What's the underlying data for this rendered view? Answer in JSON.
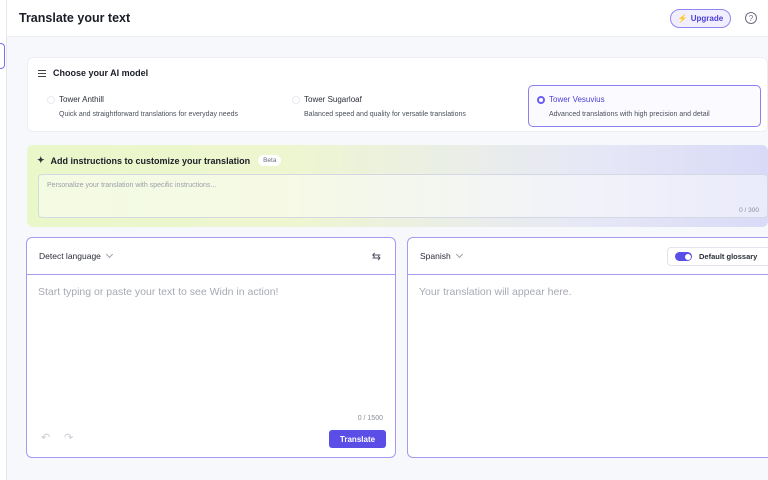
{
  "header": {
    "title": "Translate your text",
    "upgrade_label": "Upgrade",
    "upgrade_icon": "lightning-bolt-icon",
    "help_icon": "question-circle-icon"
  },
  "models": {
    "heading": "Choose your AI model",
    "icon": "sliders-icon",
    "options": [
      {
        "name": "Tower Anthill",
        "description": "Quick and straightforward translations for everyday needs",
        "selected": false
      },
      {
        "name": "Tower Sugarloaf",
        "description": "Balanced speed and quality for versatile translations",
        "selected": false
      },
      {
        "name": "Tower Vesuvius",
        "description": "Advanced translations with high precision and detail",
        "selected": true
      }
    ]
  },
  "instructions": {
    "heading": "Add instructions to customize your translation",
    "badge": "Beta",
    "placeholder": "Personalize your translation with specific instructions...",
    "counter": "0 / 300"
  },
  "source": {
    "language": "Detect language",
    "placeholder": "Start typing or paste your text to see Widn in action!",
    "counter": "0 / 1500",
    "translate_label": "Translate"
  },
  "target": {
    "language": "Spanish",
    "placeholder": "Your translation will appear here.",
    "glossary_label": "Default glossary",
    "glossary_enabled": true
  },
  "colors": {
    "accent": "#5b4ee6",
    "selected_border": "#8a80f0"
  }
}
